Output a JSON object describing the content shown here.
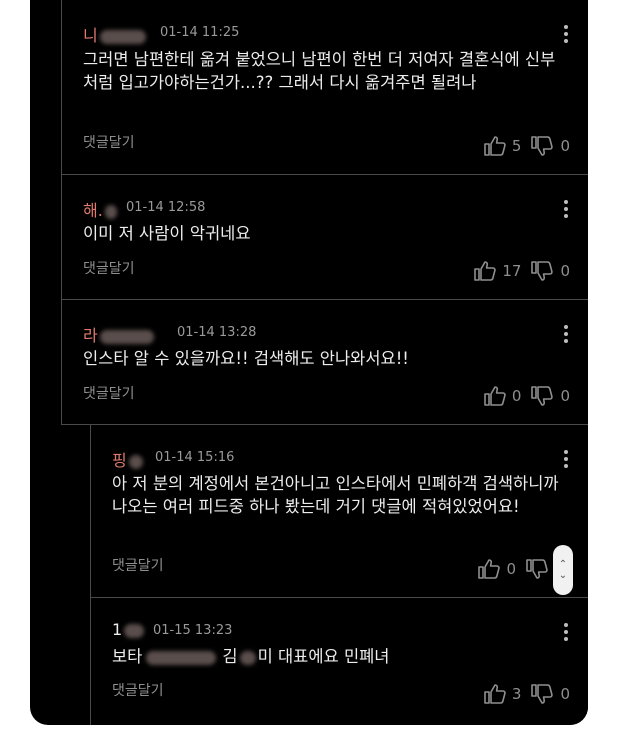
{
  "comments": [
    {
      "name": "니",
      "time": "01-14 11:25",
      "text": "그러면 남편한테 옮겨 붙었으니 남편이 한번 더 저여자 결혼식에 신부처럼 입고가야하는건가...?? 그래서 다시 옮겨주면 될려나",
      "reply_label": "댓글달기",
      "likes": "5",
      "dislikes": "0"
    },
    {
      "name": "해.",
      "time": "01-14 12:58",
      "text": "이미 저 사람이 악귀네요",
      "reply_label": "댓글달기",
      "likes": "17",
      "dislikes": "0"
    },
    {
      "name": "라",
      "time": "01-14 13:28",
      "text": "인스타 알 수 있을까요!! 검색해도 안나와서요!!",
      "reply_label": "댓글달기",
      "likes": "0",
      "dislikes": "0"
    },
    {
      "name": "핑",
      "time": "01-14 15:16",
      "text": "아 저 분의 계정에서 본건아니고 인스타에서 민폐하객 검색하니까 나오는 여러 피드중 하나 봤는데 거기 댓글에 적혀있었어요!",
      "reply_label": "댓글달기",
      "likes": "0",
      "dislikes": "0"
    },
    {
      "name": "1",
      "time": "01-15 13:23",
      "text_prefix": "보타",
      "text_mid": "김",
      "text_suffix": "미 대표에요 민폐녀",
      "reply_label": "댓글달기",
      "likes": "3",
      "dislikes": "0"
    }
  ],
  "colors": {
    "name": "#e07a6e",
    "background": "#000000",
    "text": "#ededed"
  },
  "icons": [
    "thumbs-up-icon",
    "thumbs-down-icon",
    "more-vertical-icon",
    "scroll-updown-icon"
  ]
}
